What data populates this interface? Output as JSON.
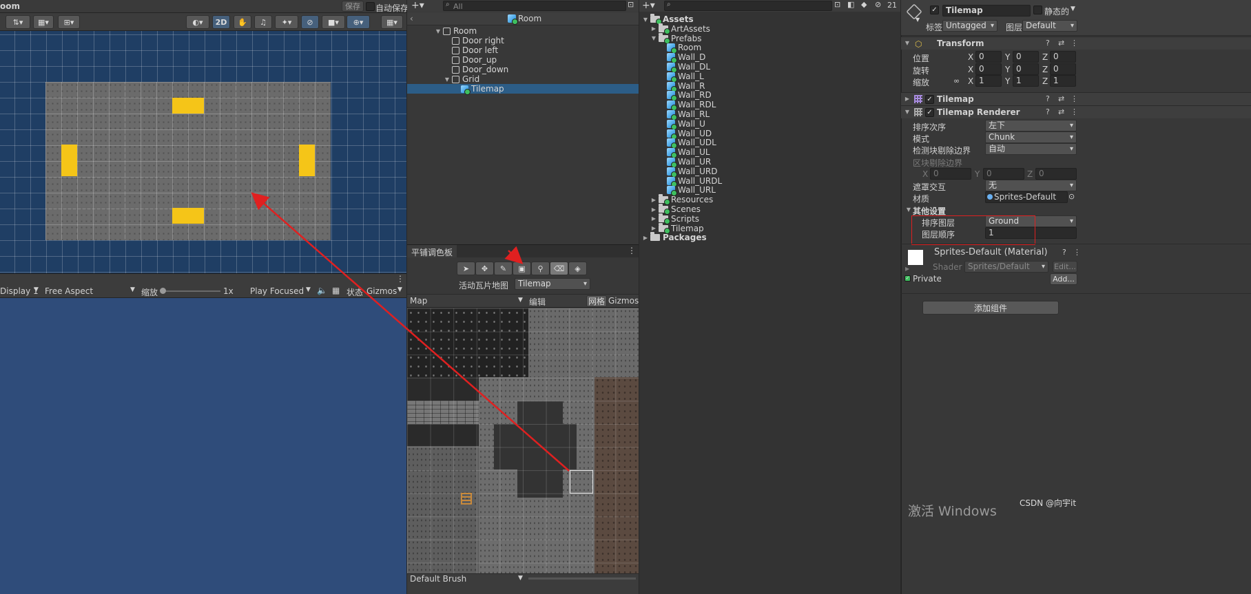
{
  "scene": {
    "title": "oom",
    "save_label": "保存",
    "autosave_label": "自动保存",
    "mode_2d": "2D"
  },
  "game": {
    "display": "Display 1",
    "aspect": "Free Aspect",
    "zoom_label": "缩放",
    "zoom_value": "1x",
    "play_mode": "Play Focused",
    "stats_label": "状态",
    "gizmos_label": "Gizmos"
  },
  "hierarchy": {
    "search_placeholder": "All",
    "scene_name": "Room",
    "items": [
      {
        "label": "Room",
        "depth": 0,
        "expanded": true
      },
      {
        "label": "Door right",
        "depth": 1
      },
      {
        "label": "Door left",
        "depth": 1
      },
      {
        "label": "Door_up",
        "depth": 1
      },
      {
        "label": "Door_down",
        "depth": 1
      },
      {
        "label": "Grid",
        "depth": 1,
        "expanded": true
      },
      {
        "label": "Tilemap",
        "depth": 2,
        "selected": true
      }
    ]
  },
  "project": {
    "search_placeholder": "",
    "hidden_count": "21",
    "items": [
      {
        "label": "Assets",
        "type": "folder",
        "depth": 0,
        "expanded": true
      },
      {
        "label": "ArtAssets",
        "type": "folder",
        "depth": 1,
        "collapsed": true
      },
      {
        "label": "Prefabs",
        "type": "folder",
        "depth": 1,
        "expanded": true
      },
      {
        "label": "Room",
        "type": "prefab",
        "depth": 2
      },
      {
        "label": "Wall_D",
        "type": "prefab",
        "depth": 2
      },
      {
        "label": "Wall_DL",
        "type": "prefab",
        "depth": 2
      },
      {
        "label": "Wall_L",
        "type": "prefab",
        "depth": 2
      },
      {
        "label": "Wall_R",
        "type": "prefab",
        "depth": 2
      },
      {
        "label": "Wall_RD",
        "type": "prefab",
        "depth": 2
      },
      {
        "label": "Wall_RDL",
        "type": "prefab",
        "depth": 2
      },
      {
        "label": "Wall_RL",
        "type": "prefab",
        "depth": 2
      },
      {
        "label": "Wall_U",
        "type": "prefab",
        "depth": 2
      },
      {
        "label": "Wall_UD",
        "type": "prefab",
        "depth": 2
      },
      {
        "label": "Wall_UDL",
        "type": "prefab",
        "depth": 2
      },
      {
        "label": "Wall_UL",
        "type": "prefab",
        "depth": 2
      },
      {
        "label": "Wall_UR",
        "type": "prefab",
        "depth": 2
      },
      {
        "label": "Wall_URD",
        "type": "prefab",
        "depth": 2
      },
      {
        "label": "Wall_URDL",
        "type": "prefab",
        "depth": 2
      },
      {
        "label": "Wall_URL",
        "type": "prefab",
        "depth": 2
      },
      {
        "label": "Resources",
        "type": "folder",
        "depth": 1,
        "collapsed": true
      },
      {
        "label": "Scenes",
        "type": "folder",
        "depth": 1,
        "collapsed": true
      },
      {
        "label": "Scripts",
        "type": "folder",
        "depth": 1,
        "collapsed": true
      },
      {
        "label": "Tilemap",
        "type": "folder",
        "depth": 1,
        "collapsed": true
      },
      {
        "label": "Packages",
        "type": "folder",
        "depth": 0,
        "collapsed": true
      }
    ]
  },
  "palette": {
    "tab_label": "平铺调色板",
    "active_tilemap_label": "活动瓦片地图",
    "active_tilemap_value": "Tilemap",
    "palette_value": "Map",
    "edit_label": "编辑",
    "grid_label": "网格",
    "gizmos_label": "Gizmos",
    "brush_value": "Default Brush"
  },
  "inspector": {
    "object_name": "Tilemap",
    "static_label": "静态的",
    "tag_label": "标签",
    "tag_value": "Untagged",
    "layer_label": "图层",
    "layer_value": "Default",
    "transform": {
      "title": "Transform",
      "position_label": "位置",
      "rotation_label": "旋转",
      "scale_label": "缩放",
      "x": "X",
      "y": "Y",
      "z": "Z",
      "position": [
        "0",
        "0",
        "0"
      ],
      "rotation": [
        "0",
        "0",
        "0"
      ],
      "scale": [
        "1",
        "1",
        "1"
      ]
    },
    "tilemap_title": "Tilemap",
    "renderer": {
      "title": "Tilemap Renderer",
      "sort_order_label": "排序次序",
      "sort_order_value": "左下",
      "mode_label": "模式",
      "mode_value": "Chunk",
      "culling_label": "检测块剔除边界",
      "culling_value": "自动",
      "chunk_bounds_label": "区块剔除边界",
      "chunk_bounds": [
        "0",
        "0",
        "0"
      ],
      "mask_label": "遮罩交互",
      "mask_value": "无",
      "material_label": "材质",
      "material_value": "Sprites-Default",
      "other_label": "其他设置",
      "sorting_layer_label": "排序图层",
      "sorting_layer_value": "Ground",
      "order_in_layer_label": "图层顺序",
      "order_in_layer_value": "1"
    },
    "material": {
      "title": "Sprites-Default (Material)",
      "shader_label": "Shader",
      "shader_value": "Sprites/Default",
      "edit_label": "Edit...",
      "private_label": "Private",
      "add_label": "Add..."
    },
    "add_component_label": "添加组件"
  },
  "watermark": {
    "windows": "激活 Windows",
    "csdn": "CSDN @向宇it"
  },
  "colors": {
    "scene_bg": "#1f3e64",
    "game_bg": "#2f4c7a",
    "room_floor": "#6e6e6e",
    "door_yellow": "#f5c518",
    "selection": "#2c5d87",
    "annotation_red": "#e02020"
  }
}
